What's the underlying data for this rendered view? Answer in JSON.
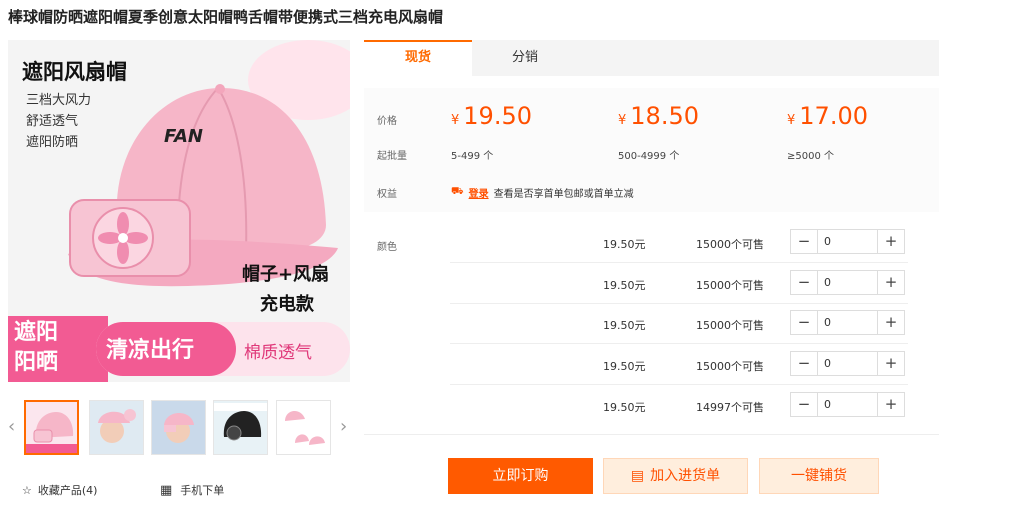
{
  "product": {
    "title": "棒球帽防晒遮阳帽夏季创意太阳帽鸭舌帽带便携式三档充电风扇帽"
  },
  "gallery": {
    "main_image": {
      "headline": "遮阳风扇帽",
      "features": [
        "三档大风力",
        "舒适透气",
        "遮阳防晒"
      ],
      "cap_text": "FAN",
      "side_text_1": "帽子+风扇",
      "side_text_2": "充电款",
      "badge_text_1": "遮阳",
      "badge_text_2": "阳晒",
      "banner_text": "清凉出行",
      "banner_sub": "棉质透气"
    },
    "favorite_label": "收藏产品(4)",
    "mobile_label": "手机下单"
  },
  "tabs": [
    {
      "label": "现货",
      "active": true
    },
    {
      "label": "分销",
      "active": false
    }
  ],
  "pricing": {
    "price_label": "价格",
    "moq_label": "起批量",
    "benefit_label": "权益",
    "currency": "¥",
    "tiers": [
      {
        "price": "19.50",
        "range": "5-499 个"
      },
      {
        "price": "18.50",
        "range": "500-4999 个"
      },
      {
        "price": "17.00",
        "range": "≥5000 个"
      }
    ],
    "benefit_login": "登录",
    "benefit_text": "查看是否享首单包邮或首单立减"
  },
  "sku": {
    "color_label": "颜色",
    "rows": [
      {
        "name": "",
        "price": "19.50元",
        "stock": "15000个可售",
        "qty": "0"
      },
      {
        "name": "",
        "price": "19.50元",
        "stock": "15000个可售",
        "qty": "0"
      },
      {
        "name": "",
        "price": "19.50元",
        "stock": "15000个可售",
        "qty": "0"
      },
      {
        "name": "",
        "price": "19.50元",
        "stock": "15000个可售",
        "qty": "0"
      },
      {
        "name": "",
        "price": "19.50元",
        "stock": "14997个可售",
        "qty": "0"
      }
    ]
  },
  "actions": {
    "buy_now": "立即订购",
    "add_to_cart": "加入进货单",
    "one_click": "一键铺货"
  },
  "colors": {
    "accent": "#ff5000",
    "accent_light": "#ffeedd",
    "banner_pink": "#f25b93",
    "cap_pink": "#f6b6c8"
  }
}
